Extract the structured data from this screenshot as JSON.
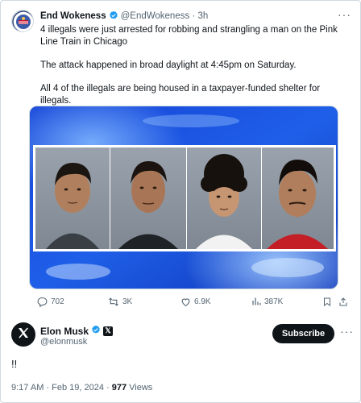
{
  "quoted_tweet": {
    "author_name": "End Wokeness",
    "handle": "@EndWokeness",
    "separator": "·",
    "time": "3h",
    "paragraphs": [
      "4 illegals were just arrested for robbing and strangling a man on the Pink Line Train in Chicago",
      "The attack happened in broad daylight at 4:45pm on Saturday.",
      "All 4 of the illegals are being housed in a taxpayer-funded shelter for illegals."
    ],
    "actions": {
      "replies": "702",
      "reposts": "3K",
      "likes": "6.9K",
      "views": "387K"
    }
  },
  "main_tweet": {
    "author_name": "Elon Musk",
    "handle": "@elonmusk",
    "subscribe_label": "Subscribe",
    "text": "!!",
    "timestamp": "9:17 AM · Feb 19, 2024 · ",
    "views_count": "977",
    "views_label": " Views"
  },
  "colors": {
    "accent_blue": "#1d9bf0",
    "text_primary": "#0f1419",
    "text_secondary": "#536471",
    "border": "#cfd9de"
  },
  "icons": [
    "verified-badge-icon",
    "more-icon",
    "reply-icon",
    "repost-icon",
    "like-icon",
    "views-icon",
    "bookmark-icon",
    "share-icon",
    "x-logo-icon"
  ]
}
